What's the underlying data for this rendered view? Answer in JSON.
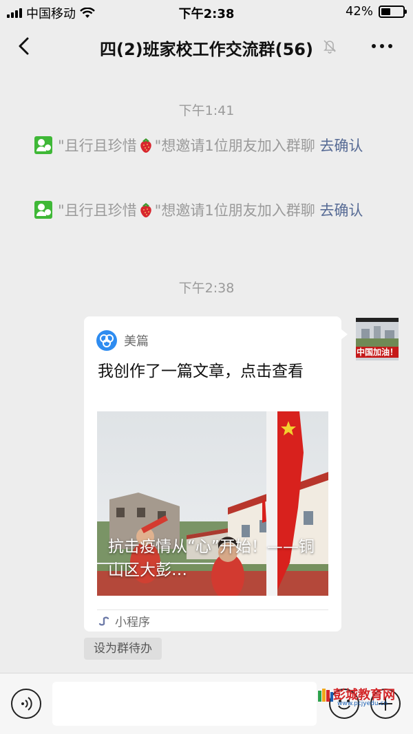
{
  "status_bar": {
    "carrier": "中国移动",
    "time": "下午2:38",
    "battery": "42%",
    "battery_level": 0.42
  },
  "header": {
    "title": "四(2)班家校工作交流群(56)",
    "back_icon": "chevron-left-icon",
    "mute_icon": "bell-muted-icon",
    "more_icon": "more-dots-icon"
  },
  "messages": {
    "ts1": "下午1:41",
    "sys1": {
      "prefix": "\"且行且珍惜",
      "suffix": "\"想邀请1位朋友加入群聊",
      "link": "去确认"
    },
    "sys2": {
      "prefix": "\"且行且珍惜",
      "suffix": "\"想邀请1位朋友加入群聊",
      "link": "去确认"
    },
    "ts2": "下午2:38",
    "card": {
      "source": "美篇",
      "title": "我创作了一篇文章，点击查看",
      "caption": "抗击疫情从“心”开始！——铜山区大彭…",
      "footer": "小程序"
    },
    "avatar_label": "中国加油！",
    "todo": "设为群待办"
  },
  "input_bar": {
    "placeholder": ""
  },
  "watermark": {
    "text": "彭城教育网",
    "url": "www.pcjyedu.cn"
  },
  "colors": {
    "background": "#ededed",
    "link": "#576b95",
    "system_text": "#9a9a9a",
    "invite_icon": "#3fb837"
  }
}
